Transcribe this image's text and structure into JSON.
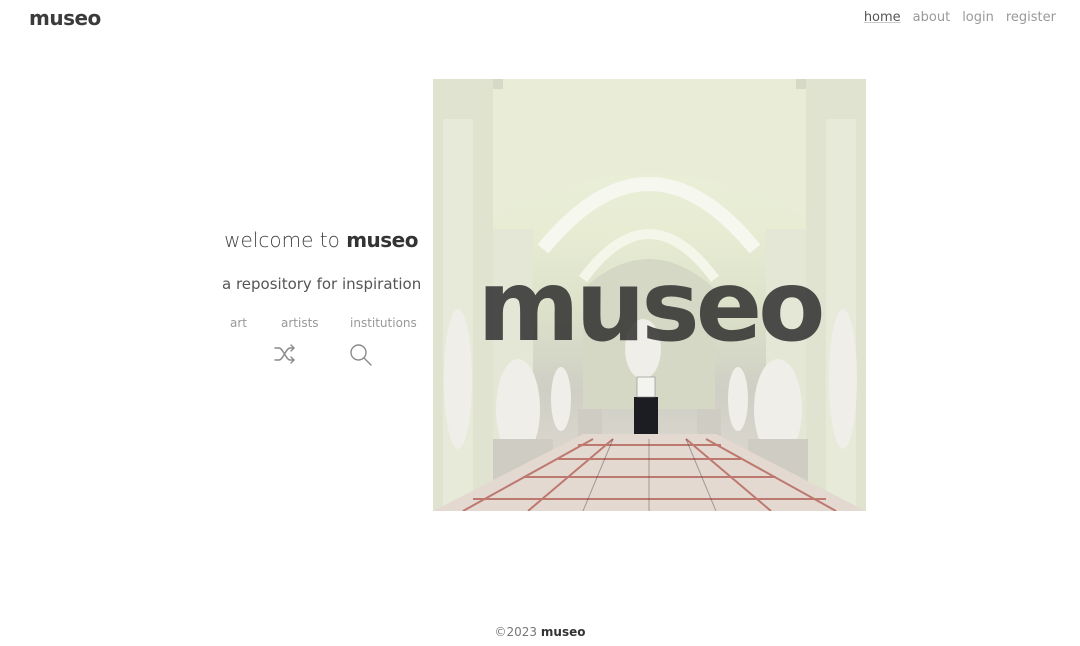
{
  "brand": {
    "logo": "museo"
  },
  "nav": {
    "home": "home",
    "about": "about",
    "login": "login",
    "register": "register"
  },
  "hero": {
    "welcome_prefix": "welcome to ",
    "welcome_brand": "museo",
    "tagline": "a repository for inspiration",
    "image_overlay_word": "museo"
  },
  "categories": {
    "art": "art",
    "artists": "artists",
    "institutions": "institutions"
  },
  "icons": {
    "shuffle": "shuffle-icon",
    "search": "search-icon"
  },
  "footer": {
    "copyright": "©2023 ",
    "brand": "museo"
  }
}
